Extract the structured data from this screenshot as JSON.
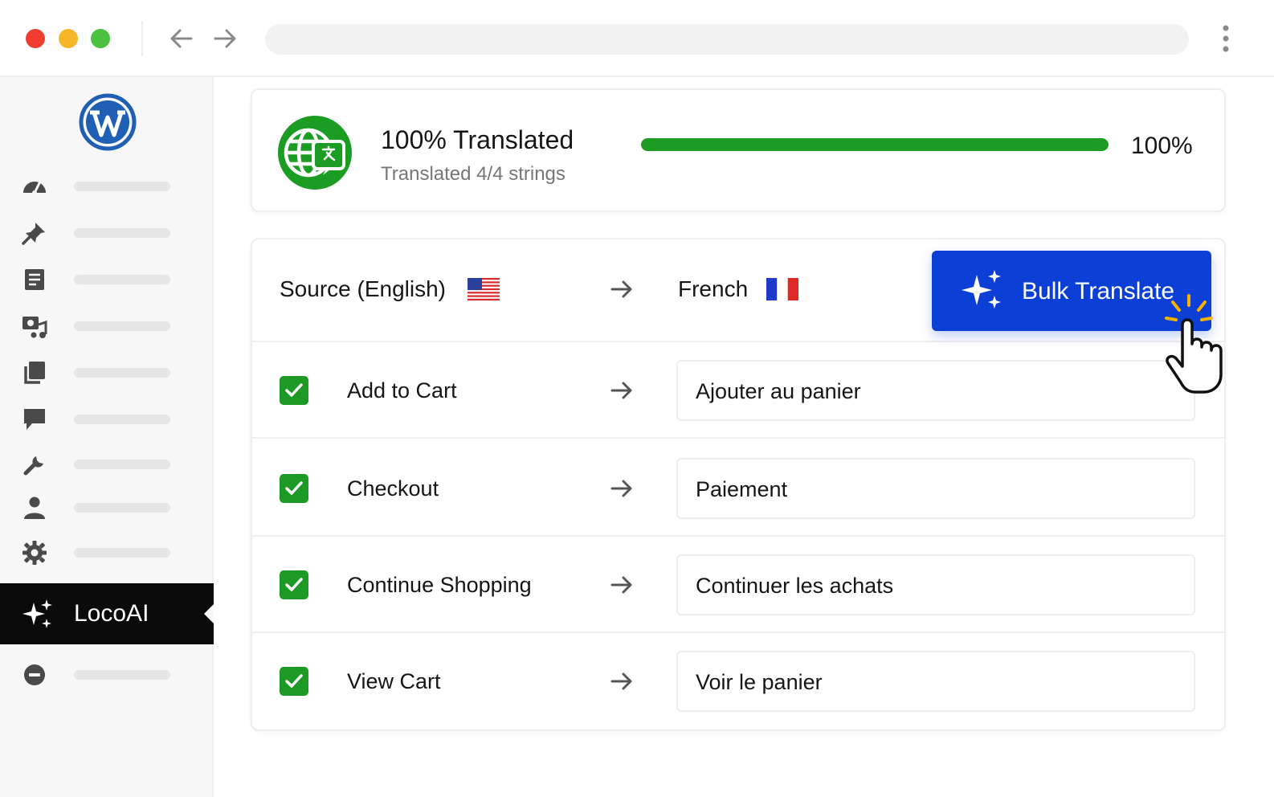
{
  "browser": {
    "url": ""
  },
  "sidebar": {
    "items": [
      {
        "icon": "dashboard-icon"
      },
      {
        "icon": "pin-icon"
      },
      {
        "icon": "pages-icon"
      },
      {
        "icon": "media-icon"
      },
      {
        "icon": "copy-icon"
      },
      {
        "icon": "comments-icon"
      },
      {
        "icon": "tools-icon"
      },
      {
        "icon": "user-icon"
      },
      {
        "icon": "settings-icon"
      }
    ],
    "active": {
      "label": "LocoAI",
      "icon": "sparkle-icon"
    },
    "collapse": {
      "icon": "collapse-icon"
    }
  },
  "progress": {
    "title": "100% Translated",
    "subtitle": "Translated 4/4 strings",
    "percent_label": "100%",
    "percent_value": 100,
    "color": "#1b9c23"
  },
  "translation": {
    "source_label": "Source (English)",
    "target_label": "French",
    "bulk_label": "Bulk Translate",
    "accent": "#0b3fd6",
    "rows": [
      {
        "source": "Add to Cart",
        "target": "Ajouter au panier",
        "checked": true
      },
      {
        "source": "Checkout",
        "target": "Paiement",
        "checked": true
      },
      {
        "source": "Continue Shopping",
        "target": "Continuer les achats",
        "checked": true
      },
      {
        "source": "View Cart",
        "target": "Voir le panier",
        "checked": true
      }
    ]
  }
}
